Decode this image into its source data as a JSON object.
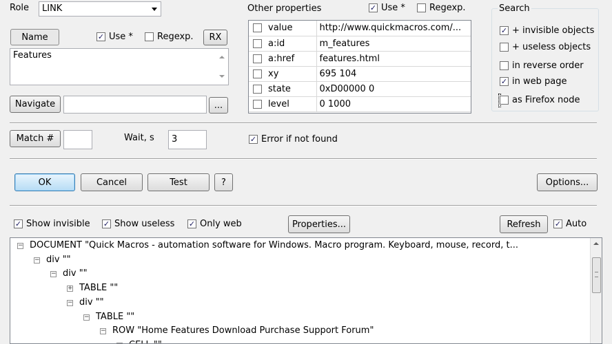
{
  "role": {
    "label": "Role",
    "value": "LINK"
  },
  "name": {
    "button": "Name",
    "use_label": "Use *",
    "use_checked": true,
    "regexp_label": "Regexp.",
    "regexp_checked": false,
    "rx_button": "RX",
    "value": "Features"
  },
  "navigate": {
    "button": "Navigate",
    "value": "",
    "browse": "..."
  },
  "match": {
    "button": "Match #",
    "value": "",
    "wait_label": "Wait, s",
    "wait_value": "3"
  },
  "error_if_not_found": {
    "label": "Error if not found",
    "checked": true
  },
  "other_props": {
    "title": "Other properties",
    "use_label": "Use *",
    "use_checked": true,
    "regexp_label": "Regexp.",
    "regexp_checked": false,
    "rows": [
      {
        "name": "value",
        "value": "http://www.quickmacros.com/...",
        "checked": false
      },
      {
        "name": "a:id",
        "value": "m_features",
        "checked": false
      },
      {
        "name": "a:href",
        "value": "features.html",
        "checked": false
      },
      {
        "name": "xy",
        "value": "695 104",
        "checked": false
      },
      {
        "name": "state",
        "value": "0xD00000 0",
        "checked": false
      },
      {
        "name": "level",
        "value": "0 1000",
        "checked": false
      }
    ]
  },
  "search": {
    "title": "Search",
    "options": [
      {
        "label": "+ invisible objects",
        "checked": true
      },
      {
        "label": "+ useless objects",
        "checked": false
      },
      {
        "label": "in reverse order",
        "checked": false
      },
      {
        "label": "in web page",
        "checked": true
      },
      {
        "label": "as Firefox node",
        "checked": false
      }
    ]
  },
  "actions": {
    "ok": "OK",
    "cancel": "Cancel",
    "test": "Test",
    "help": "?",
    "options": "Options..."
  },
  "tree_toolbar": {
    "show_invisible": {
      "label": "Show invisible",
      "checked": true
    },
    "show_useless": {
      "label": "Show useless",
      "checked": true
    },
    "only_web": {
      "label": "Only web",
      "checked": true
    },
    "properties": "Properties...",
    "refresh": "Refresh",
    "auto": {
      "label": "Auto",
      "checked": true
    }
  },
  "tree": [
    {
      "text": "DOCUMENT  \"Quick Macros - automation software for Windows. Macro program. Keyboard, mouse, record, t...",
      "expander": "−"
    },
    {
      "text": "div  \"\"",
      "expander": "−"
    },
    {
      "text": "div  \"\"",
      "expander": "−"
    },
    {
      "text": "TABLE  \"\"",
      "expander": "+"
    },
    {
      "text": "div  \"\"",
      "expander": "−"
    },
    {
      "text": "TABLE  \"\"",
      "expander": "−"
    },
    {
      "text": "ROW  \"Home Features Download Purchase Support Forum\"",
      "expander": "−"
    },
    {
      "text": "CELL  \"\"",
      "expander": "−"
    }
  ]
}
